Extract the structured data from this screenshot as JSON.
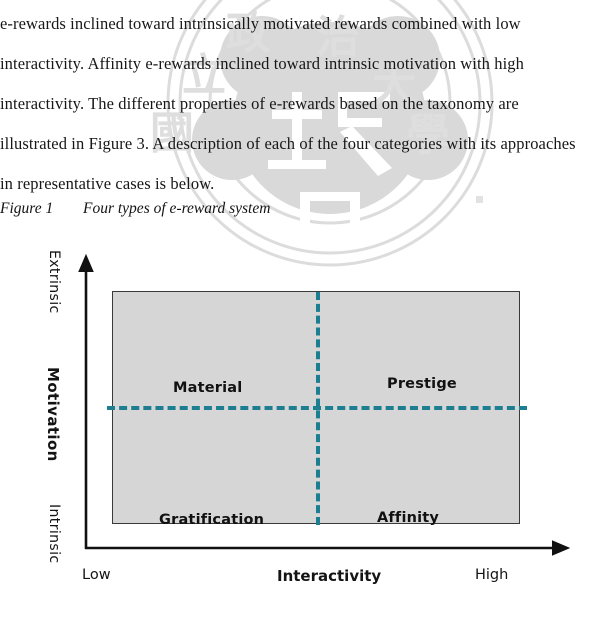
{
  "document": {
    "watermark": {
      "name": "university-seal-watermark",
      "color": "#d8d8d8",
      "characters": [
        "政",
        "治",
        "立",
        "大",
        "國",
        "學",
        "政"
      ]
    },
    "paragraph_lines": [
      "e-rewards  inclined  toward  intrinsically  motivated  rewards  combined  with  low",
      "interactivity.  Affinity  e-rewards  inclined  toward  intrinsic  motivation  with  high",
      "interactivity.  The  different  properties  of  e-rewards  based  on  the  taxonomy  are",
      "illustrated in Figure 3. A description of each of the four categories with its approaches",
      "in representative cases is below."
    ],
    "figure_caption": {
      "label": "Figure 1",
      "title": "Four types of e-reward system"
    }
  },
  "diagram": {
    "name": "four-types-of-e-reward-system",
    "colors": {
      "panel_fill": "#d6d6d6",
      "panel_border": "#3a3a3a",
      "divider": "#1b7e91",
      "axis": "#111111"
    },
    "y_axis": {
      "title": "Motivation",
      "high_label": "Extrinsic",
      "low_label": "Intrinsic"
    },
    "x_axis": {
      "title": "Interactivity",
      "low_label": "Low",
      "high_label": "High"
    },
    "quadrants": [
      {
        "key": "material",
        "label": "Material",
        "x": "low",
        "y": "extrinsic"
      },
      {
        "key": "prestige",
        "label": "Prestige",
        "x": "high",
        "y": "extrinsic"
      },
      {
        "key": "gratification",
        "label": "Gratification",
        "x": "low",
        "y": "intrinsic"
      },
      {
        "key": "affinity",
        "label": "Affinity",
        "x": "high",
        "y": "intrinsic"
      }
    ]
  }
}
